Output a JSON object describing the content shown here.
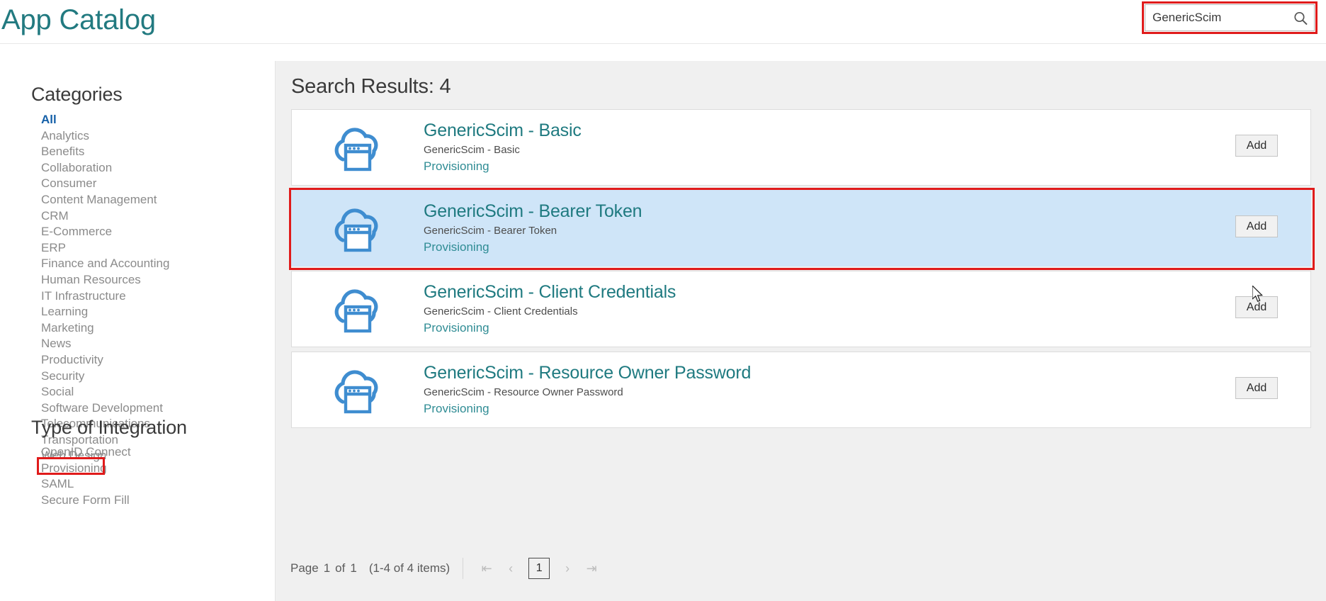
{
  "header": {
    "app_title": "App Catalog",
    "search": {
      "value": "GenericScim",
      "placeholder": "",
      "icon": "search-icon"
    }
  },
  "sidebar": {
    "categories": {
      "title": "Categories",
      "items": [
        {
          "label": "All",
          "selected": true
        },
        {
          "label": "Analytics",
          "selected": false
        },
        {
          "label": "Benefits",
          "selected": false
        },
        {
          "label": "Collaboration",
          "selected": false
        },
        {
          "label": "Consumer",
          "selected": false
        },
        {
          "label": "Content Management",
          "selected": false
        },
        {
          "label": "CRM",
          "selected": false
        },
        {
          "label": "E-Commerce",
          "selected": false
        },
        {
          "label": "ERP",
          "selected": false
        },
        {
          "label": "Finance and Accounting",
          "selected": false
        },
        {
          "label": "Human Resources",
          "selected": false
        },
        {
          "label": "IT Infrastructure",
          "selected": false
        },
        {
          "label": "Learning",
          "selected": false
        },
        {
          "label": "Marketing",
          "selected": false
        },
        {
          "label": "News",
          "selected": false
        },
        {
          "label": "Productivity",
          "selected": false
        },
        {
          "label": "Security",
          "selected": false
        },
        {
          "label": "Social",
          "selected": false
        },
        {
          "label": "Software Development",
          "selected": false
        },
        {
          "label": "Telecommunications",
          "selected": false
        },
        {
          "label": "Transportation",
          "selected": false
        },
        {
          "label": "Web Design",
          "selected": false
        }
      ]
    },
    "type_of_integration": {
      "title": "Type of Integration",
      "items": [
        {
          "label": "OpenID Connect",
          "annotated": false
        },
        {
          "label": "Provisioning",
          "annotated": true
        },
        {
          "label": "SAML",
          "annotated": false
        },
        {
          "label": "Secure Form Fill",
          "annotated": false
        }
      ]
    }
  },
  "main": {
    "results_heading": "Search Results: 4",
    "add_label": "Add",
    "cards": [
      {
        "title": "GenericScim - Basic",
        "description": "GenericScim - Basic",
        "type": "Provisioning",
        "icon": "cloud-app-icon",
        "highlighted": false
      },
      {
        "title": "GenericScim - Bearer Token",
        "description": "GenericScim - Bearer Token",
        "type": "Provisioning",
        "icon": "cloud-app-icon",
        "highlighted": true
      },
      {
        "title": "GenericScim - Client Credentials",
        "description": "GenericScim - Client Credentials",
        "type": "Provisioning",
        "icon": "cloud-app-icon",
        "highlighted": false
      },
      {
        "title": "GenericScim - Resource Owner Password",
        "description": "GenericScim - Resource Owner Password",
        "type": "Provisioning",
        "icon": "cloud-app-icon",
        "highlighted": false
      }
    ]
  },
  "pagination": {
    "page_label": "Page",
    "page_number": "1",
    "of_label": "of",
    "page_count": "1",
    "items_summary": "(1-4 of 4 items)",
    "first_icon": "first-page-icon",
    "prev_icon": "previous-page-icon",
    "current_page": "1",
    "next_icon": "next-page-icon",
    "last_icon": "last-page-icon"
  },
  "colors": {
    "brand_teal": "#227a80",
    "accent_blue": "#3f8dd0",
    "selected_row": "#cfe5f8",
    "annotation_red": "#e01b1b",
    "link_blue": "#1560a8"
  }
}
